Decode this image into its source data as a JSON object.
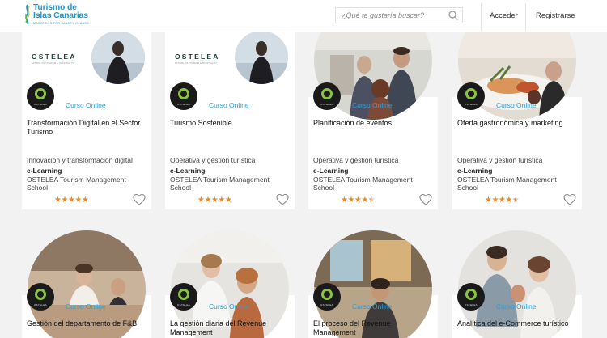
{
  "header": {
    "logo_line1": "Turismo de",
    "logo_line2": "Islas Canarias",
    "logo_tagline": "MARKETING FOR CANARY ISLANDS",
    "search_placeholder": "¿Qué te gustaría buscar?",
    "login_label": "Acceder",
    "register_label": "Registrarse"
  },
  "brand": {
    "accent": "#2ba0d8",
    "star_color": "#e8892b",
    "badge_ring": "#8ac43f"
  },
  "cards": [
    {
      "badge_text": "OSTELEA",
      "tag": "Curso Online",
      "title": "Transformación Digital en el Sector Turismo",
      "category": "Innovación y transformación digital",
      "mode": "e-Learning",
      "school": "OSTELEA Tourism Management School",
      "rating": 5,
      "stars": "★★★★★",
      "image_logo": "OSTELEA",
      "image_logo_sub": "SCHOOL OF TOURISM & HOSPITALITY"
    },
    {
      "badge_text": "OSTELEA",
      "tag": "Curso Online",
      "title": "Turismo Sostenible",
      "category": "Operativa y gestión turística",
      "mode": "e-Learning",
      "school": "OSTELEA Tourism Management School",
      "rating": 5,
      "stars": "★★★★★",
      "image_logo": "OSTELEA",
      "image_logo_sub": "SCHOOL OF TOURISM & HOSPITALITY"
    },
    {
      "badge_text": "OSTELEA",
      "tag": "Curso Online",
      "title": "Planificación de eventos",
      "category": "Operativa y gestión turística",
      "mode": "e-Learning",
      "school": "OSTELEA Tourism Management School",
      "rating": 4.5,
      "stars": "★★★★★"
    },
    {
      "badge_text": "OSTELEA",
      "tag": "Curso Online",
      "title": "Oferta gastronómica y marketing",
      "category": "Operativa y gestión turística",
      "mode": "e-Learning",
      "school": "OSTELEA Tourism Management School",
      "rating": 4.5,
      "stars": "★★★★★"
    },
    {
      "badge_text": "OSTELEA",
      "tag": "Curso Online",
      "title": "Gestión del departamento de F&B"
    },
    {
      "badge_text": "OSTELEA",
      "tag": "Curso Online",
      "title": "La gestión diaria del Revenue Management"
    },
    {
      "badge_text": "OSTELEA",
      "tag": "Curso Online",
      "title": "El proceso del Revenue Management"
    },
    {
      "badge_text": "OSTELEA",
      "tag": "Curso Online",
      "title": "Analítica del e-Commerce turístico"
    }
  ]
}
